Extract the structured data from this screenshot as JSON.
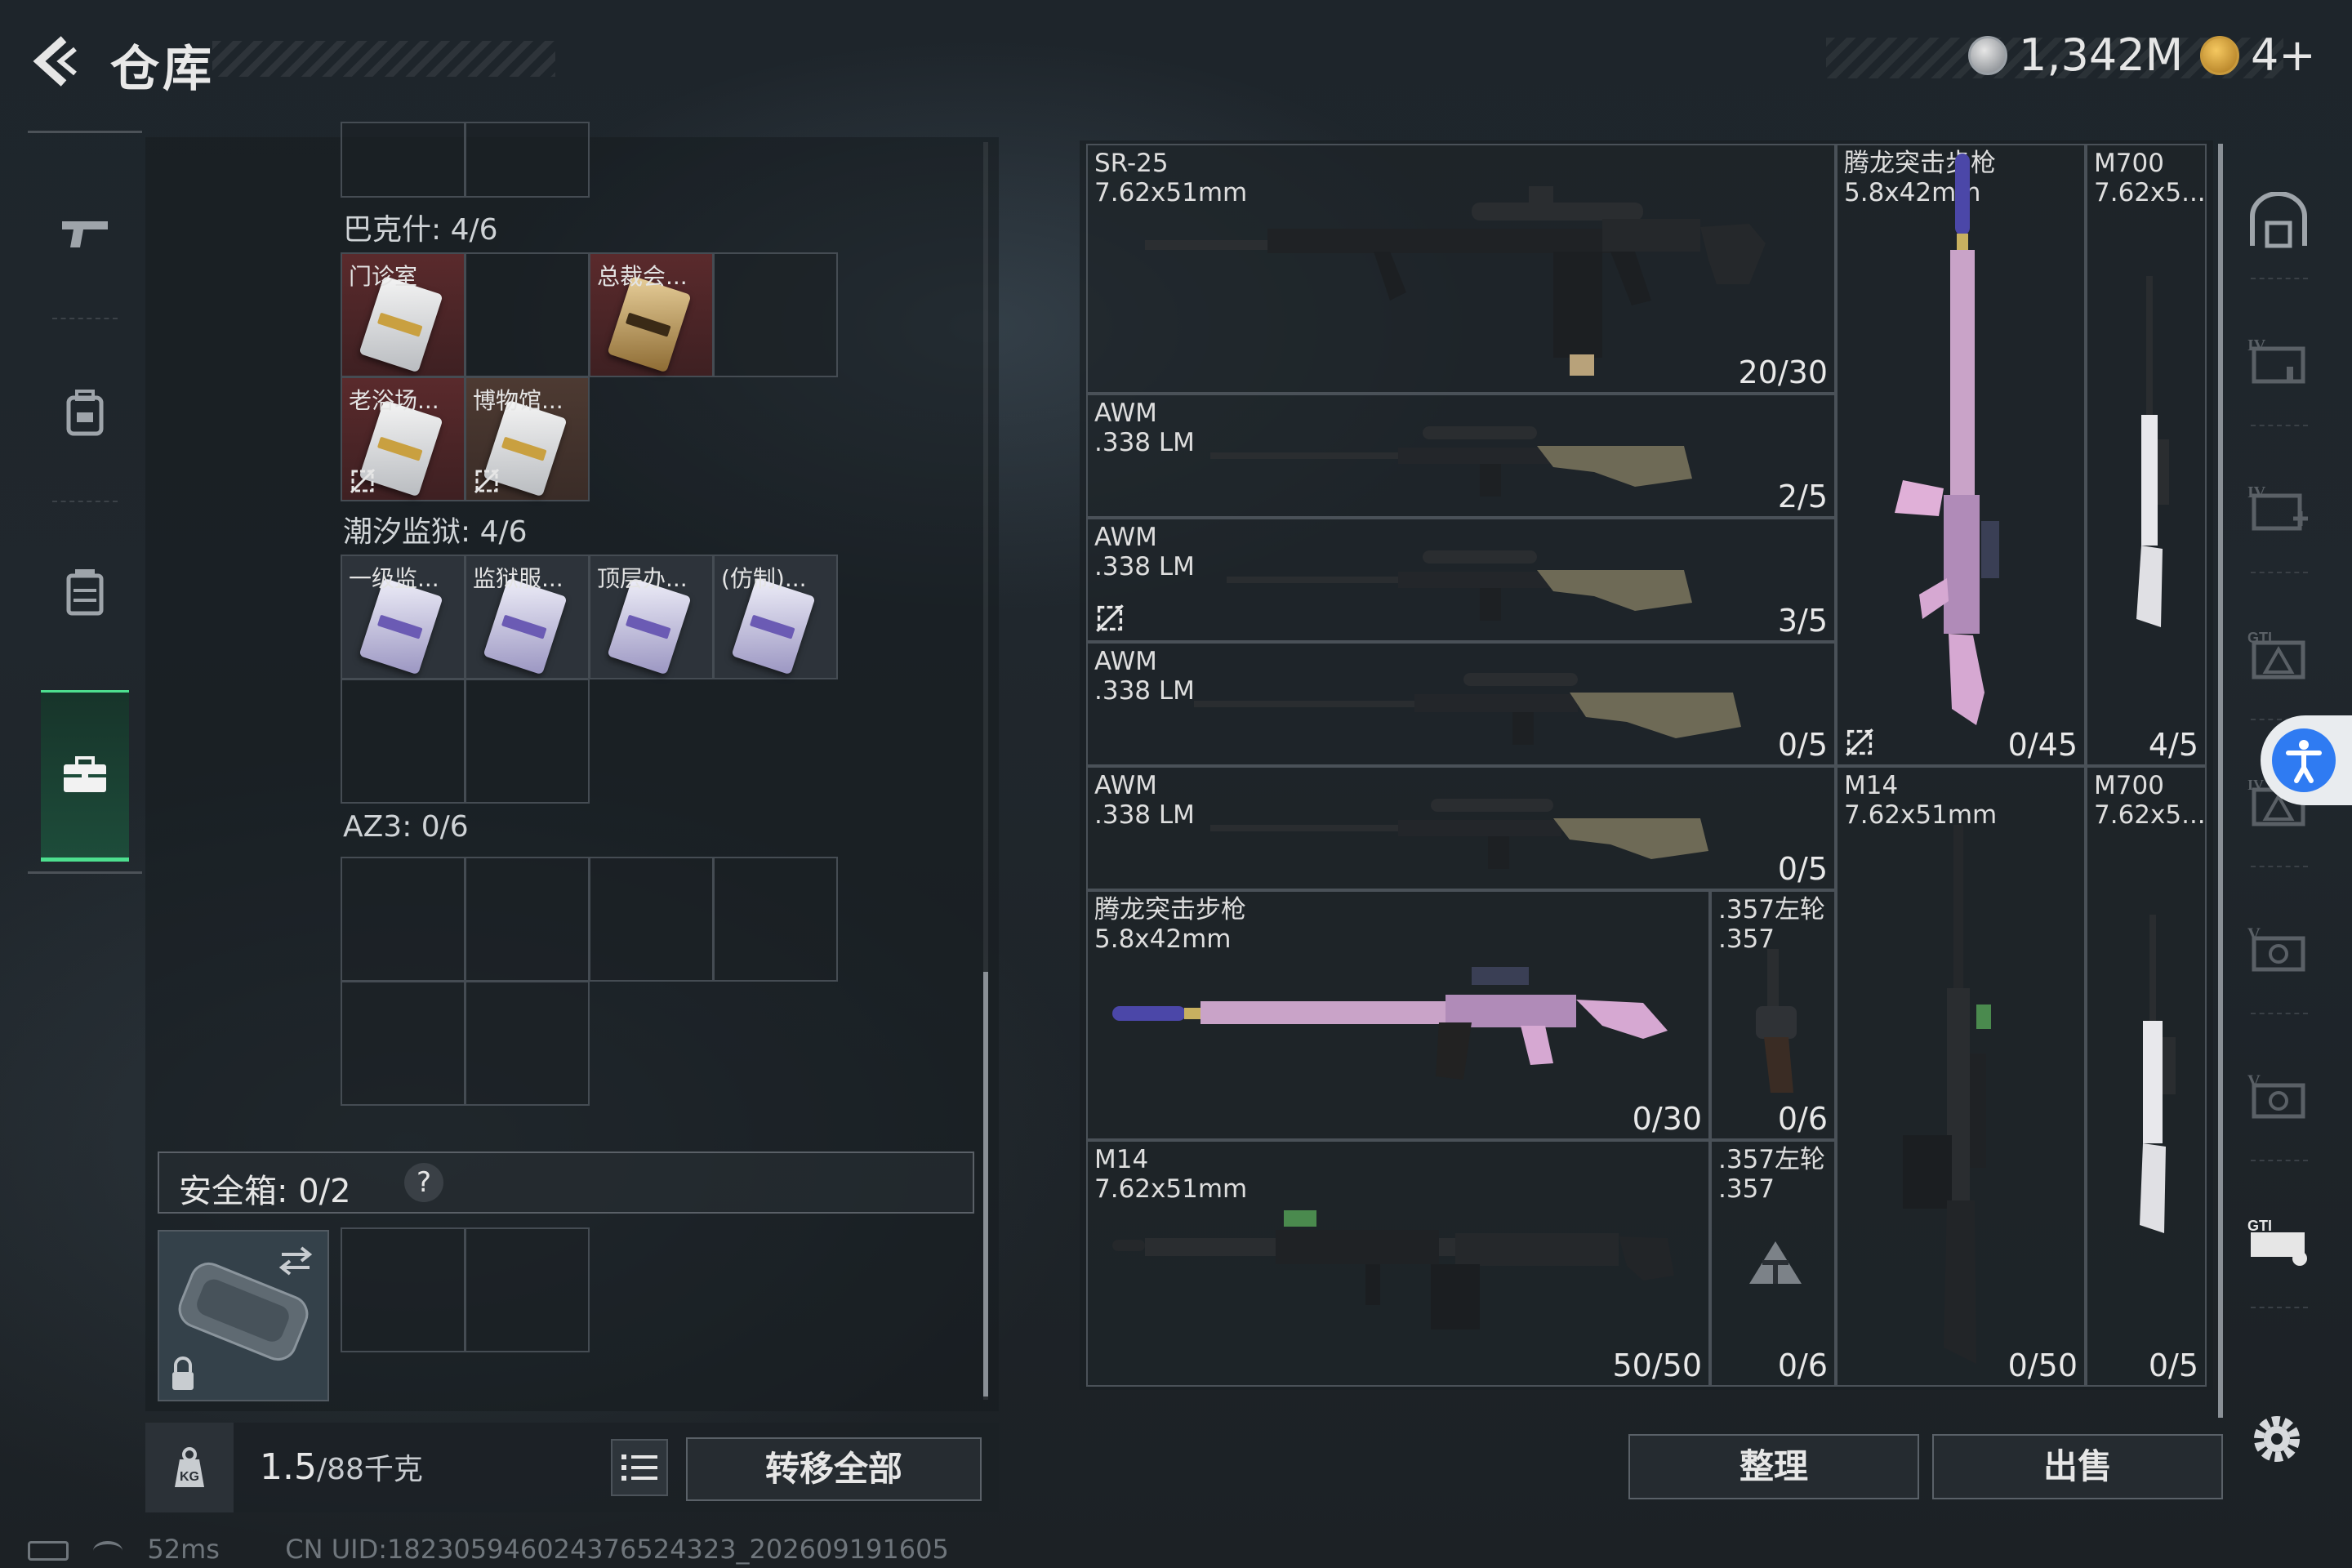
{
  "header": {
    "title": "仓库",
    "money": "1,342M",
    "tokens": "4+"
  },
  "left_nav": {
    "items": [
      "weapons",
      "backpack",
      "vest",
      "safebox"
    ],
    "active": "safebox"
  },
  "sections": [
    {
      "title": "巴克什: 4/6",
      "items": [
        {
          "label": "门诊室",
          "style": "red",
          "card": "white",
          "unusable": false
        },
        {
          "label": "总裁会...",
          "style": "red",
          "card": "gold",
          "unusable": false
        },
        {
          "label": "老浴场...",
          "style": "red",
          "card": "white",
          "unusable": true
        },
        {
          "label": "博物馆...",
          "style": "brown",
          "card": "white",
          "unusable": true
        }
      ]
    },
    {
      "title": "潮汐监狱: 4/6",
      "items": [
        {
          "label": "一级监...",
          "style": "plain",
          "card": "purple"
        },
        {
          "label": "监狱服...",
          "style": "plain",
          "card": "purple"
        },
        {
          "label": "顶层办...",
          "style": "plain",
          "card": "purple"
        },
        {
          "label": "(仿制)...",
          "style": "plain",
          "card": "purple"
        }
      ]
    },
    {
      "title": "AZ3: 0/6",
      "items": []
    }
  ],
  "safebox": {
    "label": "安全箱: 0/2",
    "help": "?"
  },
  "bottom": {
    "weight_current": "1.5",
    "weight_max": "/88千克",
    "transfer_all": "转移全部"
  },
  "status": {
    "ping": "52ms",
    "uid": "CN UID:18230594602437652432​3_202609191605"
  },
  "weapons": [
    {
      "name": "SR-25",
      "caliber": "7.62x51mm",
      "ammo": "20/30",
      "unusable": false
    },
    {
      "name": "AWM",
      "caliber": ".338 LM",
      "ammo": "2/5",
      "unusable": false
    },
    {
      "name": "AWM",
      "caliber": ".338 LM",
      "ammo": "3/5",
      "unusable": true
    },
    {
      "name": "AWM",
      "caliber": ".338 LM",
      "ammo": "0/5",
      "unusable": false
    },
    {
      "name": "AWM",
      "caliber": ".338 LM",
      "ammo": "0/5",
      "unusable": false
    },
    {
      "name": "腾龙突击步枪",
      "caliber": "5.8x42mm",
      "ammo": "0/30",
      "unusable": false
    },
    {
      "name": ".357左轮",
      "caliber": ".357",
      "ammo": "0/6",
      "unusable": false
    },
    {
      "name": "M14",
      "caliber": "7.62x51mm",
      "ammo": "50/50",
      "unusable": false
    },
    {
      "name": ".357左轮",
      "caliber": ".357",
      "ammo": "0/6",
      "unusable": false
    },
    {
      "name": "腾龙突击步枪",
      "caliber": "5.8x42mm",
      "ammo": "0/45",
      "unusable": true
    },
    {
      "name": "M700",
      "caliber": "7.62x5...",
      "ammo": "4/5",
      "unusable": false
    },
    {
      "name": "M14",
      "caliber": "7.62x51mm",
      "ammo": "0/50",
      "unusable": false
    },
    {
      "name": "M700",
      "caliber": "7.62x5...",
      "ammo": "0/5",
      "unusable": false
    }
  ],
  "actions": {
    "sort": "整理",
    "sell": "出售"
  },
  "colors": {
    "accent_green": "#4ddf8f",
    "accent_blue": "#2f7bf2",
    "slot_red": "#5a2a2c"
  }
}
